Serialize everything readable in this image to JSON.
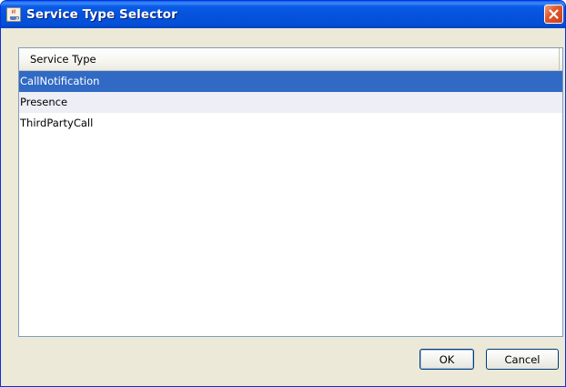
{
  "window": {
    "title": "Service Type Selector",
    "icon": "java-cup-icon",
    "close_icon": "close-icon"
  },
  "table": {
    "column_header": "Service Type",
    "rows": [
      {
        "label": "CallNotification",
        "selected": true
      },
      {
        "label": "Presence",
        "selected": false
      },
      {
        "label": "ThirdPartyCall",
        "selected": false
      }
    ]
  },
  "buttons": {
    "ok_label": "OK",
    "cancel_label": "Cancel"
  },
  "colors": {
    "titlebar": "#0552dc",
    "selection": "#316ac5",
    "alt_row": "#eeeef6",
    "dialog_bg": "#ece9d8",
    "close_button": "#e2572b"
  }
}
